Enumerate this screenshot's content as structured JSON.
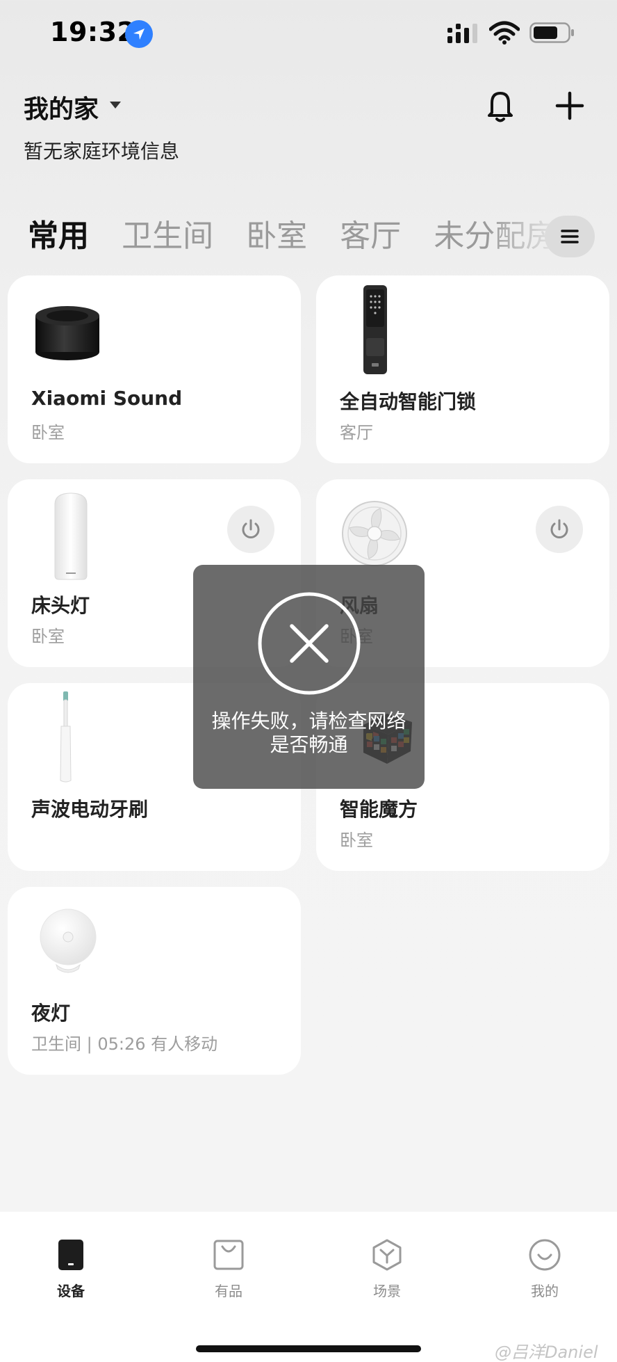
{
  "status_bar": {
    "time": "19:32"
  },
  "header": {
    "home_name": "我的家",
    "env_info": "暂无家庭环境信息"
  },
  "tabs": [
    {
      "label": "常用",
      "active": true
    },
    {
      "label": "卫生间",
      "active": false
    },
    {
      "label": "卧室",
      "active": false
    },
    {
      "label": "客厅",
      "active": false
    },
    {
      "label": "未分配房间",
      "active": false
    }
  ],
  "devices": [
    {
      "name": "Xiaomi Sound",
      "room": "卧室",
      "icon": "smart-speaker-icon",
      "has_power": false
    },
    {
      "name": "全自动智能门锁",
      "room": "客厅",
      "icon": "door-lock-icon",
      "has_power": false
    },
    {
      "name": "床头灯",
      "room": "卧室",
      "icon": "bedside-lamp-icon",
      "has_power": true
    },
    {
      "name": "风扇",
      "room": "卧室",
      "icon": "fan-icon",
      "has_power": true
    },
    {
      "name": "声波电动牙刷",
      "room": "",
      "icon": "toothbrush-icon",
      "has_power": false
    },
    {
      "name": "智能魔方",
      "room": "卧室",
      "icon": "rubiks-cube-icon",
      "has_power": false
    },
    {
      "name": "夜灯",
      "room": "卫生间 | 05:26 有人移动",
      "icon": "night-light-icon",
      "has_power": false
    }
  ],
  "toast": {
    "message": "操作失败，请检查网络是否畅通",
    "icon": "close-circle-icon"
  },
  "bottom_nav": [
    {
      "label": "设备",
      "icon": "device-icon",
      "active": true
    },
    {
      "label": "有品",
      "icon": "shopping-bag-icon",
      "active": false
    },
    {
      "label": "场景",
      "icon": "scene-icon",
      "active": false
    },
    {
      "label": "我的",
      "icon": "profile-smile-icon",
      "active": false
    }
  ],
  "watermark": "@吕洋Daniel",
  "colors": {
    "accent_blue": "#2f80ff",
    "card_bg": "#ffffff",
    "toast_bg": "#464646"
  }
}
